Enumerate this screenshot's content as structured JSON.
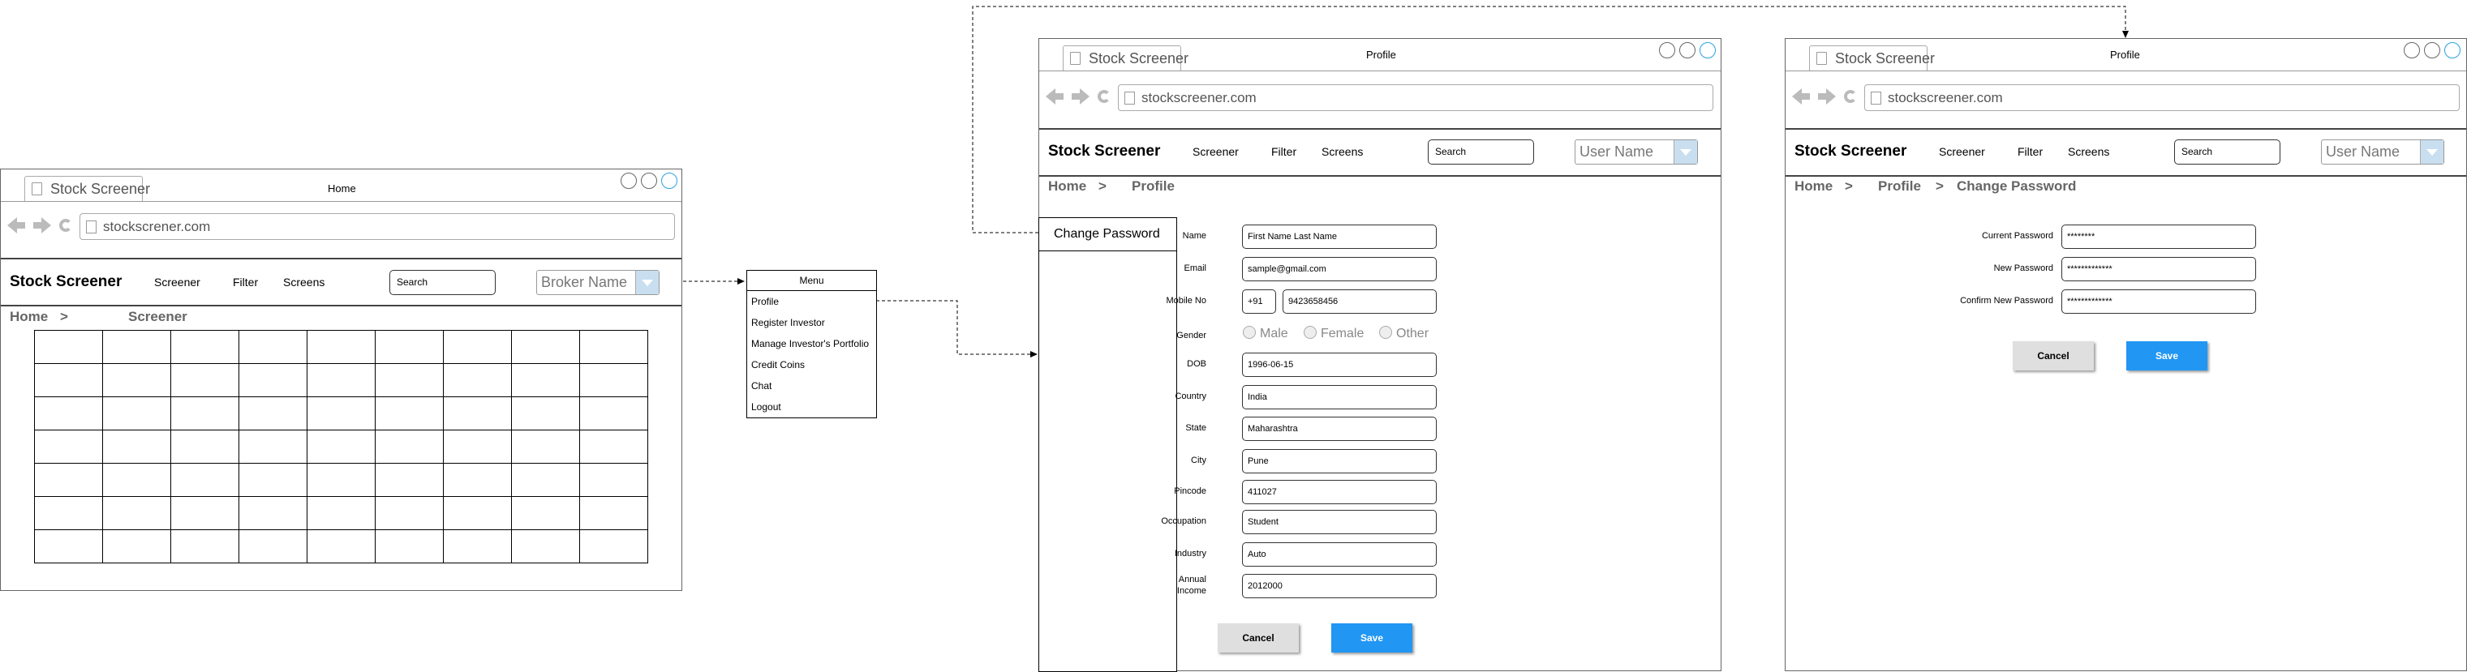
{
  "colors": {
    "accent": "#2196f3",
    "combo_button": "#c9dff0",
    "window_border": "#666666"
  },
  "home": {
    "tab": "Stock Screener",
    "title": "Home",
    "url": "stockscrener.com",
    "brand": "Stock Screener",
    "nav": [
      "Screener",
      "Filter",
      "Screens"
    ],
    "search": "Search",
    "broker": "Broker Name",
    "breadcrumb": [
      "Home",
      ">",
      "Screener"
    ]
  },
  "menu": {
    "title": "Menu",
    "items": [
      "Profile",
      "Register Investor",
      "Manage Investor's Portfolio",
      "Credit Coins",
      "Chat",
      "Logout"
    ]
  },
  "profile": {
    "tab": "Stock Screener",
    "title": "Profile",
    "url": "stockscreener.com",
    "brand": "Stock Screener",
    "nav": [
      "Screener",
      "Filter",
      "Screens"
    ],
    "search": "Search",
    "user": "User Name",
    "breadcrumb": [
      "Home",
      ">",
      "Profile"
    ],
    "side": "Change Password",
    "fields": [
      {
        "label": "Name",
        "value": "First Name Last Name"
      },
      {
        "label": "Email",
        "value": "sample@gmail.com"
      },
      {
        "label": "Mobile No",
        "code": "+91",
        "value": "9423658456"
      },
      {
        "label": "Gender",
        "options": [
          "Male",
          "Female",
          "Other"
        ]
      },
      {
        "label": "DOB",
        "value": "1996-06-15"
      },
      {
        "label": "Country",
        "value": "India"
      },
      {
        "label": "State",
        "value": "Maharashtra"
      },
      {
        "label": "City",
        "value": "Pune"
      },
      {
        "label": "Pincode",
        "value": "411027"
      },
      {
        "label": "Occupation",
        "value": "Student"
      },
      {
        "label": "Industry",
        "value": "Auto"
      },
      {
        "label": "Annual",
        "label2": "Income",
        "value": "2012000"
      }
    ],
    "cancel": "Cancel",
    "save": "Save"
  },
  "changepw": {
    "tab": "Stock Screener",
    "title": "Profile",
    "url": "stockscreener.com",
    "brand": "Stock Screener",
    "nav": [
      "Screener",
      "Filter",
      "Screens"
    ],
    "search": "Search",
    "user": "User Name",
    "breadcrumb": [
      "Home",
      ">",
      "Profile",
      ">",
      "Change Password"
    ],
    "fields": [
      {
        "label": "Current Password",
        "value": "********"
      },
      {
        "label": "New Password",
        "value": "*************"
      },
      {
        "label": "Confirm New Password",
        "value": "*************"
      }
    ],
    "cancel": "Cancel",
    "save": "Save"
  }
}
